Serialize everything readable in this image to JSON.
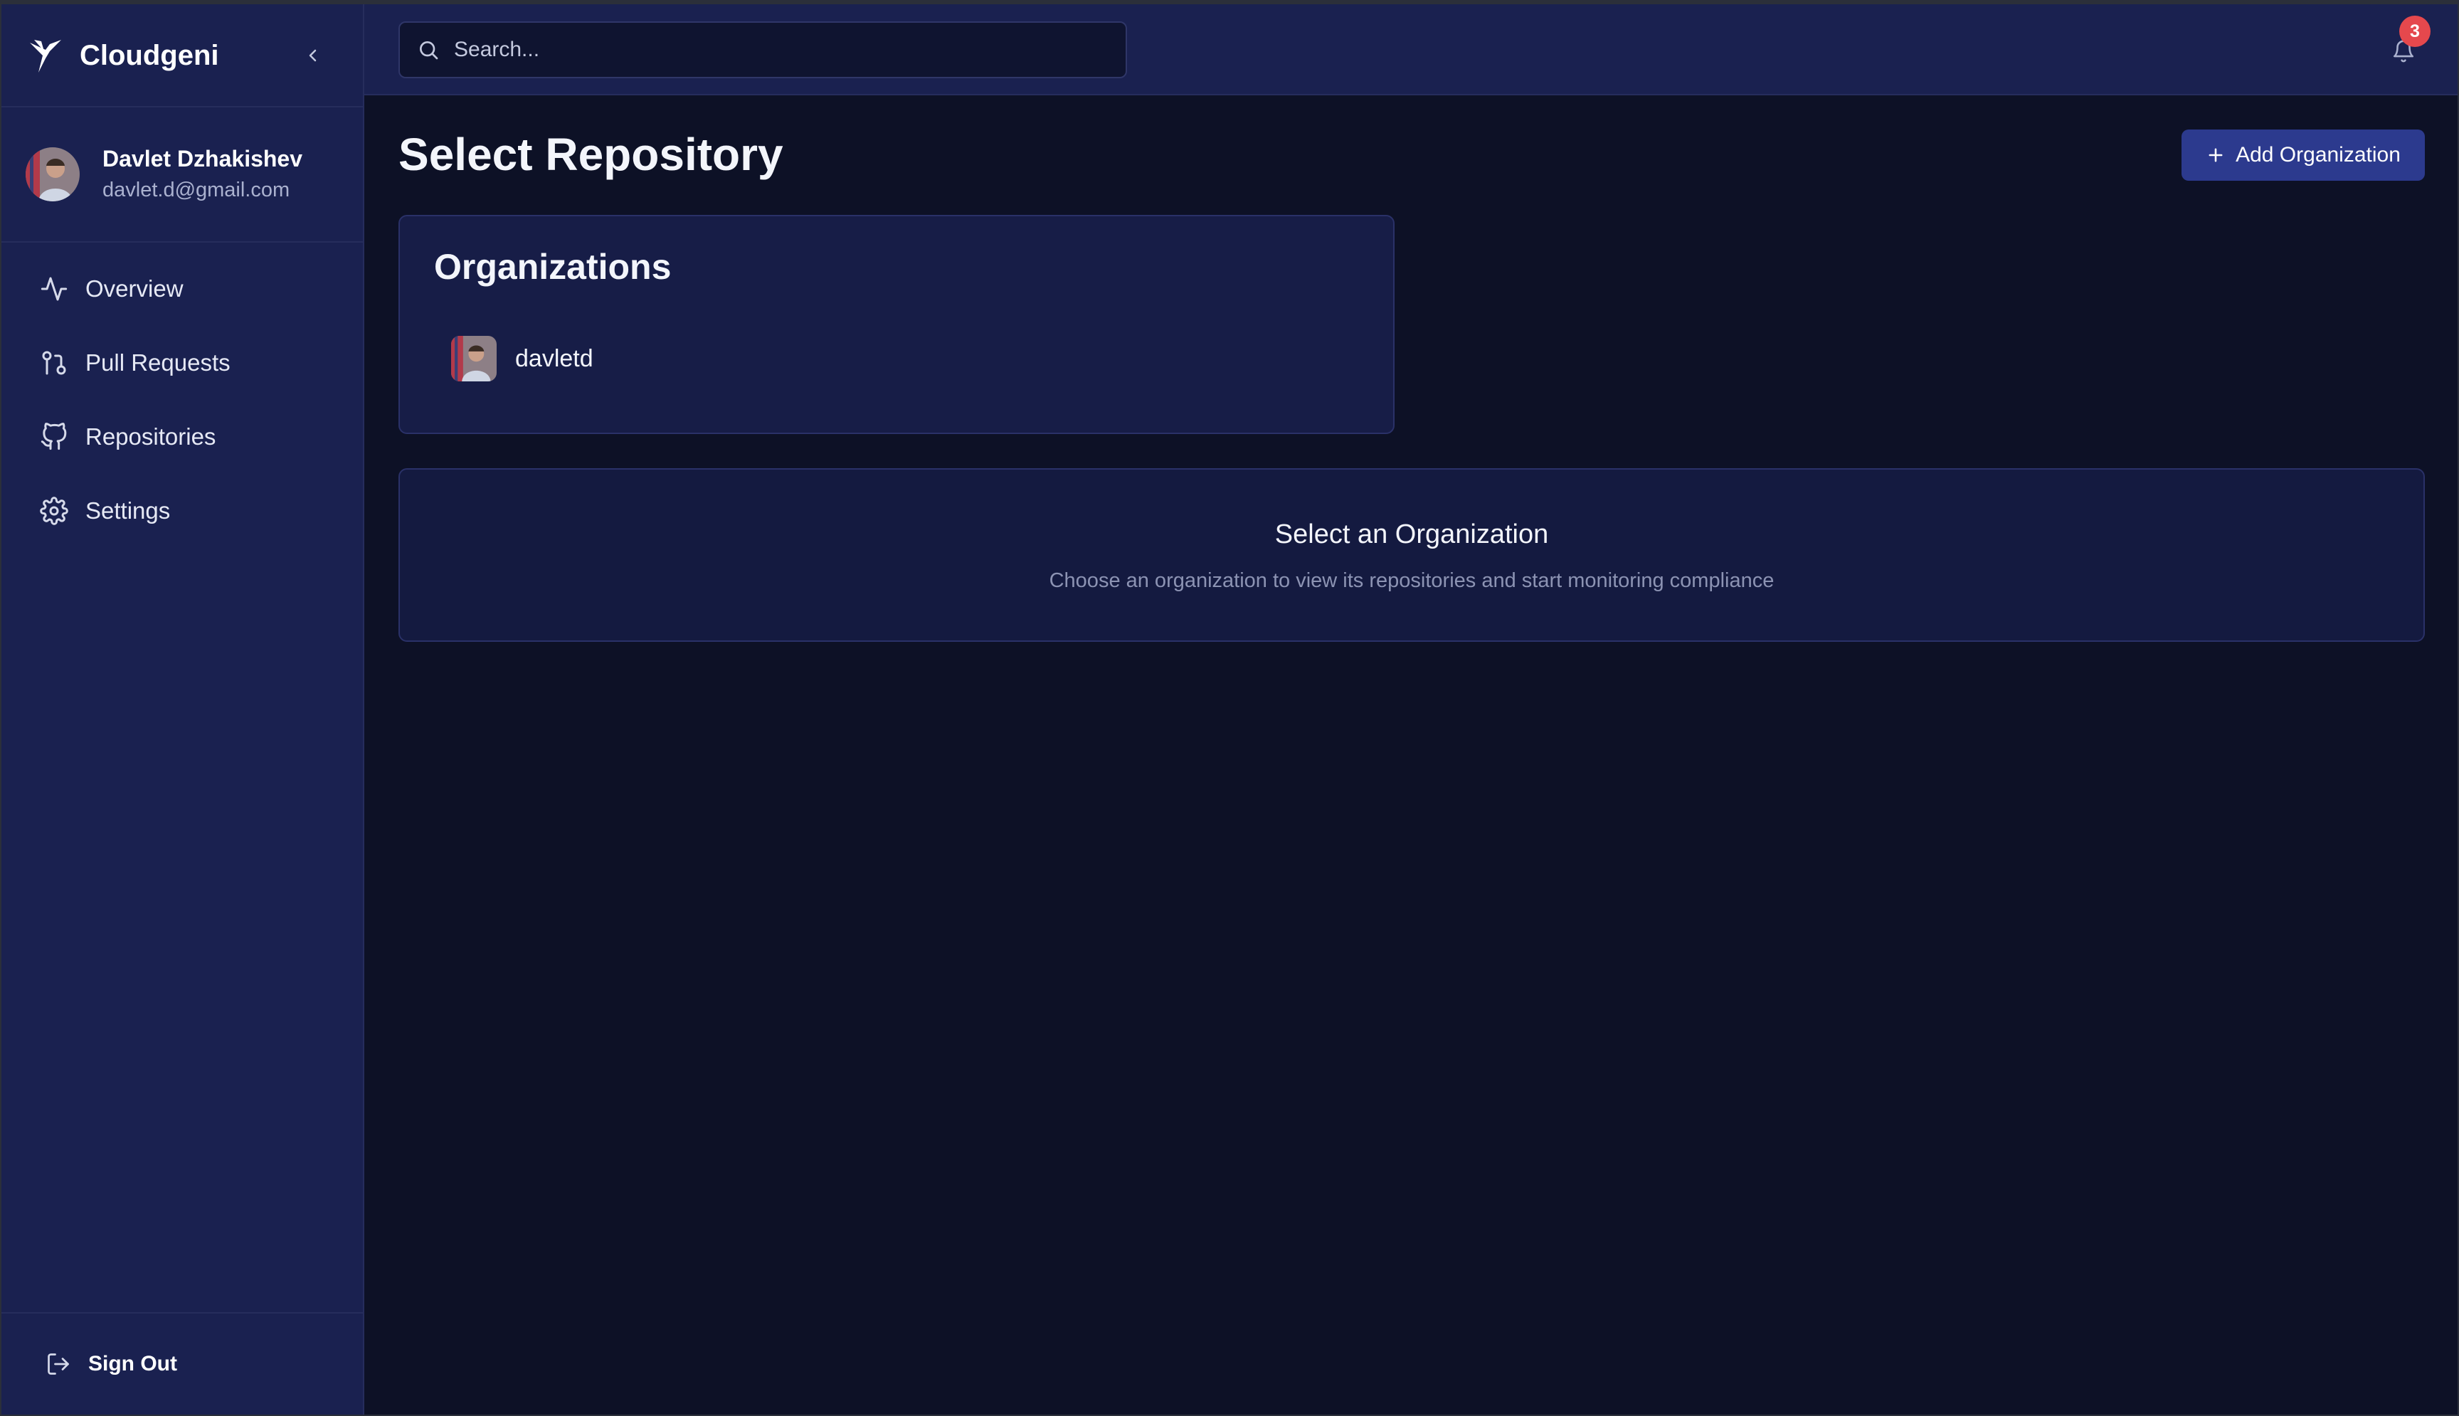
{
  "app": {
    "name": "Cloudgeni"
  },
  "user": {
    "name": "Davlet Dzhakishev",
    "email": "davlet.d@gmail.com"
  },
  "sidebar": {
    "items": [
      {
        "label": "Overview",
        "icon": "activity-icon"
      },
      {
        "label": "Pull Requests",
        "icon": "git-pull-request-icon"
      },
      {
        "label": "Repositories",
        "icon": "github-icon"
      },
      {
        "label": "Settings",
        "icon": "gear-icon"
      }
    ],
    "sign_out_label": "Sign Out"
  },
  "topbar": {
    "search_placeholder": "Search...",
    "notification_count": "3"
  },
  "main": {
    "title": "Select Repository",
    "add_org_label": "Add Organization",
    "organizations": {
      "title": "Organizations",
      "items": [
        {
          "name": "davletd"
        }
      ]
    },
    "empty_state": {
      "title": "Select an Organization",
      "subtitle": "Choose an organization to view its repositories and start monitoring compliance"
    }
  },
  "colors": {
    "background": "#0d1126",
    "sidebar": "#1a2150",
    "accent_button": "#2c3a8e",
    "badge": "#e5484d"
  }
}
